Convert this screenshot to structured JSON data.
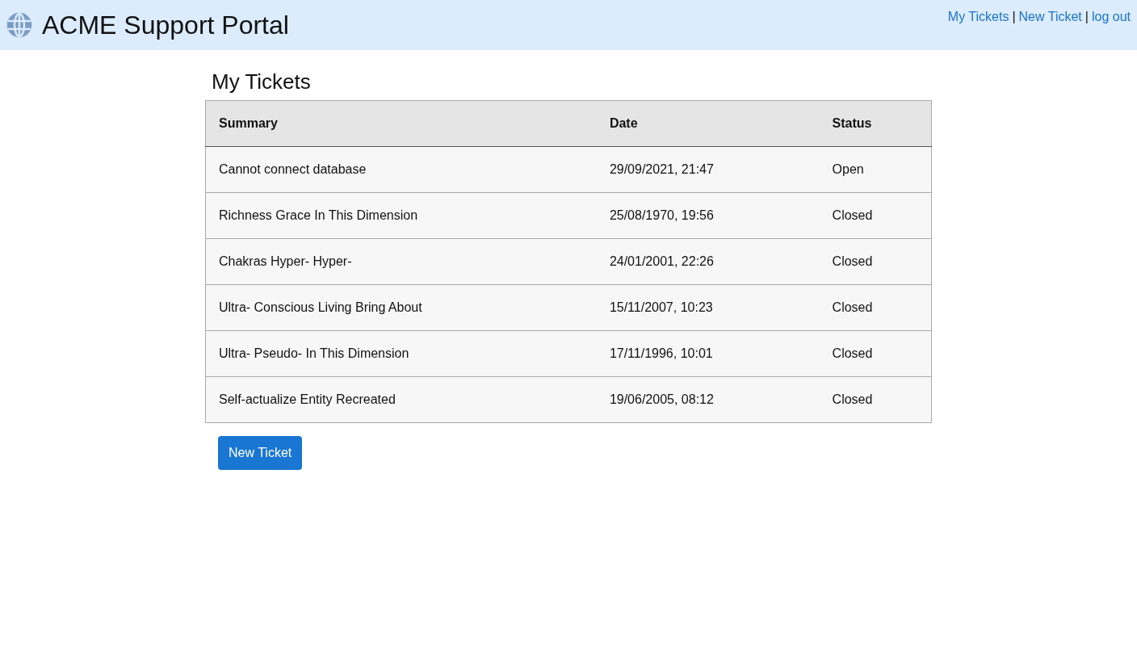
{
  "header": {
    "title": "ACME Support Portal",
    "nav": [
      {
        "kind": "link",
        "text": "My Tickets"
      },
      {
        "kind": "separator",
        "text": "|"
      },
      {
        "kind": "link",
        "text": "New Ticket"
      },
      {
        "kind": "separator",
        "text": "|"
      },
      {
        "kind": "link",
        "text": "log out"
      }
    ]
  },
  "page_title": "My Tickets",
  "table": {
    "columns": [
      "Summary",
      "Date",
      "Status"
    ],
    "rows": [
      [
        "Cannot connect database",
        "29/09/2021, 21:47",
        "Open"
      ],
      [
        "Richness Grace In This Dimension",
        "25/08/1970, 19:56",
        "Closed"
      ],
      [
        "Chakras Hyper- Hyper-",
        "24/01/2001, 22:26",
        "Closed"
      ],
      [
        "Ultra- Conscious Living Bring About",
        "15/11/2007, 10:23",
        "Closed"
      ],
      [
        "Ultra- Pseudo- In This Dimension",
        "17/11/1996, 10:01",
        "Closed"
      ],
      [
        "Self-actualize Entity Recreated",
        "19/06/2005, 08:12",
        "Closed"
      ]
    ]
  },
  "button": "New Ticket"
}
